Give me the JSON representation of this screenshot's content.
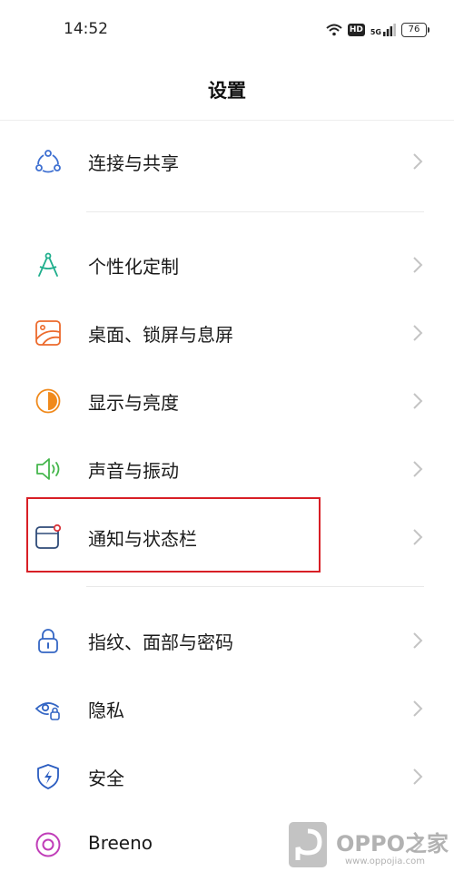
{
  "status_bar": {
    "time": "14:52",
    "hd": "HD",
    "network": "5G",
    "battery": "76"
  },
  "header": {
    "title": "设置"
  },
  "menu": [
    {
      "id": "connect-share",
      "label": "连接与共享",
      "icon": "share-nodes-icon"
    },
    {
      "id": "personalize",
      "label": "个性化定制",
      "icon": "compass-icon"
    },
    {
      "id": "desktop-lock",
      "label": "桌面、锁屏与息屏",
      "icon": "wallpaper-icon"
    },
    {
      "id": "display",
      "label": "显示与亮度",
      "icon": "brightness-icon"
    },
    {
      "id": "sound",
      "label": "声音与振动",
      "icon": "speaker-icon"
    },
    {
      "id": "notifications",
      "label": "通知与状态栏",
      "icon": "notification-icon"
    },
    {
      "id": "fingerprint",
      "label": "指纹、面部与密码",
      "icon": "lock-icon"
    },
    {
      "id": "privacy",
      "label": "隐私",
      "icon": "privacy-eye-icon"
    },
    {
      "id": "security",
      "label": "安全",
      "icon": "shield-bolt-icon"
    },
    {
      "id": "breeno",
      "label": "Breeno",
      "icon": "breeno-icon"
    }
  ],
  "watermark": {
    "text": "OPPO之家",
    "url": "www.oppojia.com"
  },
  "colors": {
    "highlight": "#d81f26",
    "chevron": "#c4c4c4",
    "text": "#1a1a1a"
  }
}
